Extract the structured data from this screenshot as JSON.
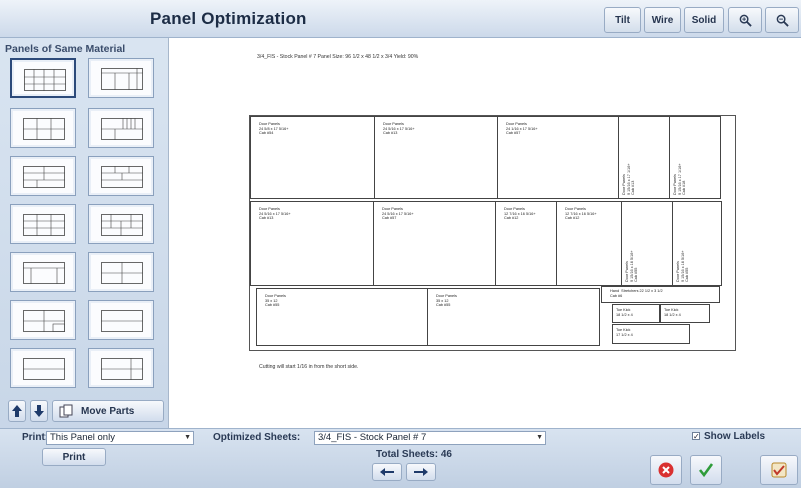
{
  "header": {
    "title": "Panel Optimization",
    "buttons": [
      {
        "label": "Tilt"
      },
      {
        "label": "Wire"
      },
      {
        "label": "Solid"
      }
    ],
    "zoom_in_icon": "zoom-in-icon",
    "zoom_out_icon": "zoom-out-icon"
  },
  "sidebar": {
    "title": "Panels of Same Material",
    "move_parts_label": "Move Parts"
  },
  "canvas": {
    "header_text": "3/4_FIS - Stock Panel # 7 Panel Size: 96 1/2 x 48 1/2 x 3/4 Yield: 90%",
    "footer_text": "Cutting will start 1/16 in from the short side.",
    "parts": [
      {
        "text": "Door Panels\n24 5/8 x 17 5/16+\nCab #54"
      },
      {
        "text": "Door Panels\n24 5/16 x 17 5/16+\nCab #13"
      },
      {
        "text": "Door Panels\n24 1/16 x 17 5/16+\nCab #57"
      },
      {
        "text": "Door Panels\n9 15/16 x 17 1/16+\nCab #13"
      },
      {
        "text": "Door Panels\n9 15/16 x 17 1/16+\nCab #18"
      },
      {
        "text": "Door Panels\n24 5/16 x 17 5/16+\nCab #13"
      },
      {
        "text": "Door Panels\n24 5/16 x 17 5/16+\nCab #57"
      },
      {
        "text": "Door Panels\n12 7/16 x 16 5/16+\nCab #12"
      },
      {
        "text": "Door Panels\n12 7/16 x 16 5/16+\nCab #12"
      },
      {
        "text": "Door Panels\n9 15/16 x 16 5/16+\nCab #55"
      },
      {
        "text": "Door Panels\n9 15/16 x 16 5/16+\nCab #55"
      },
      {
        "text": "Door Panels\n35 x 12\nCab #55"
      },
      {
        "text": "Door Panels\n35 x 12\nCab #55"
      },
      {
        "text": "Hand  Stretchers 22 1/2 x 3 1/2\nCab #6"
      },
      {
        "text": "Toe Kick\n18 1/2 x 4"
      },
      {
        "text": "Toe Kick\n18 1/2 x 4"
      },
      {
        "text": "Toe Kick\n17 1/2 x 4"
      }
    ]
  },
  "bottom": {
    "print_label": "Print:",
    "print_value": "This Panel only",
    "print_button": "Print",
    "optimized_label": "Optimized Sheets:",
    "optimized_value": "3/4_FIS - Stock Panel  # 7",
    "total_sheets": "Total Sheets: 46",
    "show_labels": "Show Labels",
    "show_labels_checked": true,
    "cancel_icon": "cancel-icon",
    "accept_icon": "checkmark-icon",
    "ok_icon": "ok-icon"
  },
  "colors": {
    "accent": "#2a3a55",
    "cancel": "#d93030",
    "accept": "#2f9c3a"
  }
}
